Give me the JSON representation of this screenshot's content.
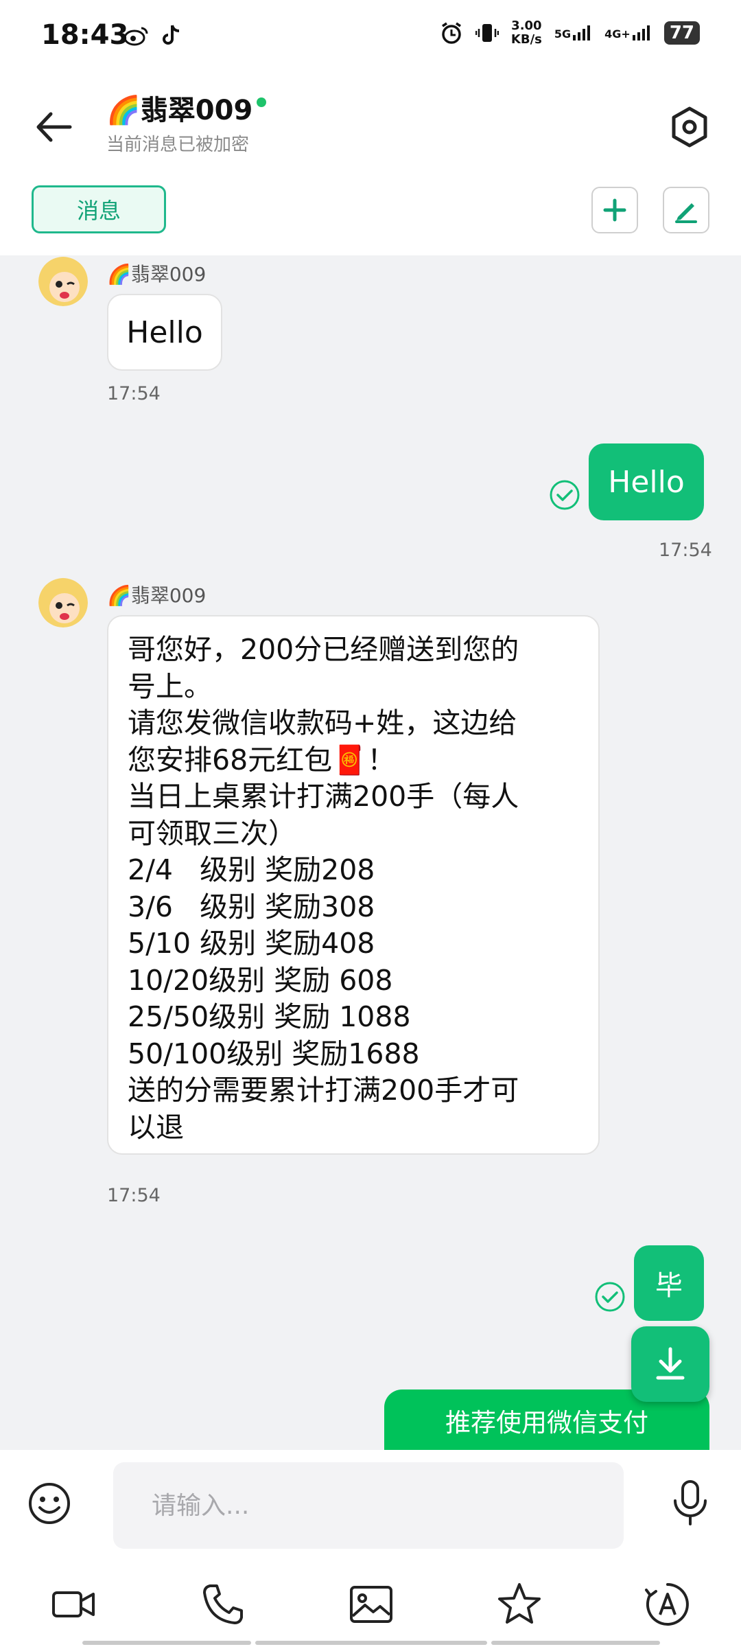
{
  "status_bar": {
    "time": "18:43",
    "speed_value": "3.00",
    "speed_unit": "KB/s",
    "net_5g": "5G",
    "net_4g": "4G+",
    "battery": "77"
  },
  "header": {
    "contact_name": "🌈翡翠009",
    "subtitle": "当前消息已被加密"
  },
  "toolbar": {
    "tab_label": "消息"
  },
  "messages": [
    {
      "sender": "🌈翡翠009",
      "text": "Hello",
      "time": "17:54"
    },
    {
      "text": "Hello",
      "time": "17:54"
    },
    {
      "sender": "🌈翡翠009",
      "text": "哥您好，200分已经赠送到您的\n号上。\n请您发微信收款码+姓，这边给\n您安排68元红包🧧！\n当日上桌累计打满200手（每人\n可领取三次）\n2/4   级别 奖励208\n3/6   级别 奖励308\n5/10 级别 奖励408\n10/20级别 奖励 608\n25/50级别 奖励 1088\n50/100级别 奖励1688\n送的分需要累计打满200手才可\n以退",
      "time": "17:54"
    },
    {
      "text": "毕"
    },
    {
      "text": "推荐使用微信支付"
    }
  ],
  "input": {
    "placeholder": "请输入..."
  },
  "colors": {
    "accent": "#12bf78",
    "chat_bg": "#f1f2f4"
  }
}
